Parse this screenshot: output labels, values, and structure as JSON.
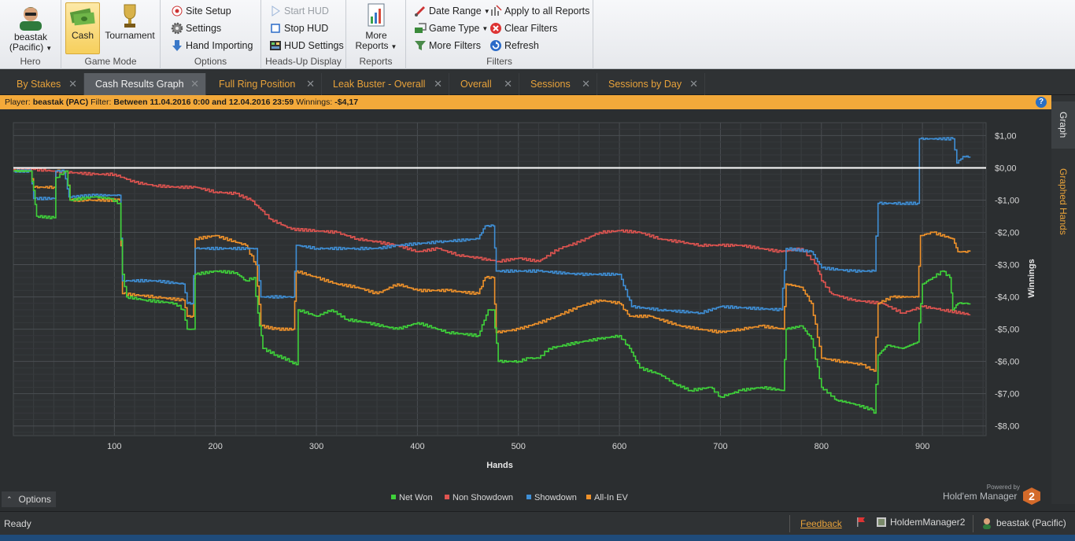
{
  "ribbon": {
    "hero": {
      "user": "beastak",
      "site": "(Pacific)",
      "label": "Hero"
    },
    "game_mode": {
      "cash": "Cash",
      "tournament": "Tournament",
      "label": "Game Mode"
    },
    "options": {
      "site_setup": "Site Setup",
      "settings": "Settings",
      "hand_importing": "Hand Importing",
      "label": "Options"
    },
    "hud": {
      "start": "Start HUD",
      "stop": "Stop HUD",
      "settings": "HUD Settings",
      "label": "Heads-Up Display"
    },
    "reports": {
      "more_line1": "More",
      "more_line2": "Reports",
      "label": "Reports"
    },
    "filters": {
      "date_range": "Date Range",
      "game_type": "Game Type",
      "more_filters": "More Filters",
      "apply_all": "Apply to all Reports",
      "clear": "Clear Filters",
      "refresh": "Refresh",
      "label": "Filters"
    }
  },
  "tabs": [
    {
      "label": "By Stakes"
    },
    {
      "label": "Cash Results Graph"
    },
    {
      "label": "Full Ring Position"
    },
    {
      "label": "Leak Buster - Overall"
    },
    {
      "label": "Overall"
    },
    {
      "label": "Sessions"
    },
    {
      "label": "Sessions by Day"
    }
  ],
  "infobar": {
    "player_label": "Player:",
    "player": "beastak (PAC)",
    "filter_label": "Filter:",
    "filter": "Between 11.04.2016 0:00 and 12.04.2016 23:59",
    "winnings_label": "Winnings:",
    "winnings": "-$4,17"
  },
  "sidetabs": {
    "graph": "Graph",
    "graphed_hands": "Graphed Hands"
  },
  "chart_data": {
    "type": "line",
    "xlabel": "Hands",
    "ylabel": "Winnings",
    "xlim": [
      0,
      963
    ],
    "ylim": [
      -8.3,
      1.4
    ],
    "x_ticks": [
      100,
      200,
      300,
      400,
      500,
      600,
      700,
      800,
      900
    ],
    "y_ticks": [
      1,
      0,
      -1,
      -2,
      -3,
      -4,
      -5,
      -6,
      -7,
      -8
    ],
    "y_tick_labels": [
      "$1,00",
      "$0,00",
      "-$1,00",
      "-$2,00",
      "-$3,00",
      "-$4,00",
      "-$5,00",
      "-$6,00",
      "-$7,00",
      "-$8,00"
    ],
    "grid": true,
    "legend": "bottom-center",
    "zero_line": true,
    "series": [
      {
        "name": "Net Won",
        "color": "#3fd23a",
        "points": [
          [
            0,
            -0.1
          ],
          [
            17,
            -0.1
          ],
          [
            20,
            -0.7
          ],
          [
            23,
            -1.5
          ],
          [
            40,
            -1.55
          ],
          [
            42,
            -0.3
          ],
          [
            52,
            -0.1
          ],
          [
            56,
            -1.0
          ],
          [
            80,
            -0.9
          ],
          [
            95,
            -0.95
          ],
          [
            105,
            -1.1
          ],
          [
            108,
            -3.3
          ],
          [
            112,
            -4.0
          ],
          [
            130,
            -4.1
          ],
          [
            160,
            -4.2
          ],
          [
            168,
            -4.4
          ],
          [
            172,
            -5.0
          ],
          [
            178,
            -5.0
          ],
          [
            180,
            -3.3
          ],
          [
            200,
            -3.2
          ],
          [
            220,
            -3.25
          ],
          [
            230,
            -3.5
          ],
          [
            238,
            -3.4
          ],
          [
            242,
            -4.5
          ],
          [
            247,
            -5.6
          ],
          [
            260,
            -5.8
          ],
          [
            275,
            -6.0
          ],
          [
            280,
            -6.1
          ],
          [
            282,
            -4.4
          ],
          [
            300,
            -4.6
          ],
          [
            315,
            -4.4
          ],
          [
            330,
            -4.7
          ],
          [
            350,
            -4.8
          ],
          [
            380,
            -5.0
          ],
          [
            400,
            -4.8
          ],
          [
            430,
            -5.1
          ],
          [
            460,
            -5.2
          ],
          [
            470,
            -4.4
          ],
          [
            475,
            -4.4
          ],
          [
            480,
            -6.0
          ],
          [
            500,
            -6.0
          ],
          [
            510,
            -5.9
          ],
          [
            520,
            -5.9
          ],
          [
            530,
            -5.6
          ],
          [
            560,
            -5.4
          ],
          [
            580,
            -5.3
          ],
          [
            600,
            -5.2
          ],
          [
            610,
            -5.6
          ],
          [
            620,
            -6.2
          ],
          [
            640,
            -6.4
          ],
          [
            655,
            -6.7
          ],
          [
            670,
            -6.9
          ],
          [
            690,
            -6.8
          ],
          [
            700,
            -7.1
          ],
          [
            720,
            -6.9
          ],
          [
            740,
            -6.8
          ],
          [
            762,
            -6.9
          ],
          [
            765,
            -5.0
          ],
          [
            780,
            -4.9
          ],
          [
            790,
            -5.3
          ],
          [
            800,
            -6.8
          ],
          [
            815,
            -7.2
          ],
          [
            830,
            -7.3
          ],
          [
            850,
            -7.5
          ],
          [
            852,
            -7.6
          ],
          [
            856,
            -5.8
          ],
          [
            865,
            -5.5
          ],
          [
            880,
            -5.6
          ],
          [
            895,
            -5.4
          ],
          [
            900,
            -3.6
          ],
          [
            910,
            -3.4
          ],
          [
            920,
            -3.2
          ],
          [
            927,
            -3.4
          ],
          [
            930,
            -4.4
          ],
          [
            935,
            -4.2
          ],
          [
            947,
            -4.2
          ]
        ]
      },
      {
        "name": "Non Showdown",
        "color": "#e05450",
        "points": [
          [
            0,
            -0.05
          ],
          [
            20,
            -0.05
          ],
          [
            40,
            -0.1
          ],
          [
            60,
            -0.15
          ],
          [
            80,
            -0.2
          ],
          [
            100,
            -0.2
          ],
          [
            120,
            -0.45
          ],
          [
            140,
            -0.55
          ],
          [
            160,
            -0.6
          ],
          [
            180,
            -0.6
          ],
          [
            200,
            -0.75
          ],
          [
            220,
            -0.8
          ],
          [
            235,
            -1.0
          ],
          [
            245,
            -1.3
          ],
          [
            255,
            -1.6
          ],
          [
            275,
            -1.9
          ],
          [
            300,
            -1.95
          ],
          [
            320,
            -2.0
          ],
          [
            340,
            -2.2
          ],
          [
            360,
            -2.3
          ],
          [
            380,
            -2.4
          ],
          [
            400,
            -2.6
          ],
          [
            420,
            -2.5
          ],
          [
            440,
            -2.7
          ],
          [
            460,
            -2.8
          ],
          [
            480,
            -2.9
          ],
          [
            500,
            -2.8
          ],
          [
            520,
            -2.9
          ],
          [
            540,
            -2.5
          ],
          [
            560,
            -2.3
          ],
          [
            580,
            -2.0
          ],
          [
            600,
            -1.95
          ],
          [
            620,
            -2.0
          ],
          [
            640,
            -2.2
          ],
          [
            660,
            -2.3
          ],
          [
            680,
            -2.4
          ],
          [
            700,
            -2.4
          ],
          [
            720,
            -2.4
          ],
          [
            740,
            -2.5
          ],
          [
            760,
            -2.6
          ],
          [
            780,
            -2.5
          ],
          [
            795,
            -3.0
          ],
          [
            800,
            -3.5
          ],
          [
            810,
            -3.9
          ],
          [
            830,
            -4.1
          ],
          [
            860,
            -4.2
          ],
          [
            880,
            -4.5
          ],
          [
            900,
            -4.3
          ],
          [
            920,
            -4.4
          ],
          [
            947,
            -4.55
          ]
        ]
      },
      {
        "name": "Showdown",
        "color": "#3f8fd6",
        "points": [
          [
            0,
            -0.1
          ],
          [
            17,
            -0.1
          ],
          [
            20,
            -0.95
          ],
          [
            40,
            -0.95
          ],
          [
            42,
            -0.1
          ],
          [
            50,
            -0.1
          ],
          [
            55,
            -0.9
          ],
          [
            80,
            -0.85
          ],
          [
            105,
            -0.85
          ],
          [
            108,
            -3.5
          ],
          [
            140,
            -3.5
          ],
          [
            168,
            -3.6
          ],
          [
            172,
            -4.2
          ],
          [
            177,
            -4.2
          ],
          [
            180,
            -2.5
          ],
          [
            240,
            -2.5
          ],
          [
            245,
            -4.0
          ],
          [
            277,
            -4.0
          ],
          [
            280,
            -2.4
          ],
          [
            300,
            -2.5
          ],
          [
            340,
            -2.5
          ],
          [
            360,
            -2.5
          ],
          [
            380,
            -2.4
          ],
          [
            420,
            -2.3
          ],
          [
            460,
            -2.2
          ],
          [
            467,
            -1.8
          ],
          [
            475,
            -1.8
          ],
          [
            478,
            -3.2
          ],
          [
            520,
            -3.2
          ],
          [
            560,
            -3.3
          ],
          [
            600,
            -3.3
          ],
          [
            612,
            -4.3
          ],
          [
            640,
            -4.4
          ],
          [
            680,
            -4.5
          ],
          [
            700,
            -4.3
          ],
          [
            760,
            -4.4
          ],
          [
            765,
            -2.5
          ],
          [
            790,
            -2.6
          ],
          [
            800,
            -3.1
          ],
          [
            830,
            -3.2
          ],
          [
            852,
            -3.2
          ],
          [
            856,
            -1.1
          ],
          [
            880,
            -1.1
          ],
          [
            895,
            -1.1
          ],
          [
            897,
            0.9
          ],
          [
            930,
            0.9
          ],
          [
            934,
            0.15
          ],
          [
            940,
            0.35
          ],
          [
            947,
            0.35
          ]
        ]
      },
      {
        "name": "All-In EV",
        "color": "#f0922a",
        "points": [
          [
            0,
            -0.1
          ],
          [
            17,
            -0.1
          ],
          [
            20,
            -0.6
          ],
          [
            40,
            -0.6
          ],
          [
            42,
            -0.1
          ],
          [
            52,
            -0.1
          ],
          [
            56,
            -1.0
          ],
          [
            80,
            -1.0
          ],
          [
            105,
            -1.0
          ],
          [
            108,
            -3.9
          ],
          [
            140,
            -4.0
          ],
          [
            168,
            -4.1
          ],
          [
            172,
            -4.6
          ],
          [
            177,
            -4.6
          ],
          [
            180,
            -2.2
          ],
          [
            200,
            -2.1
          ],
          [
            230,
            -2.4
          ],
          [
            240,
            -3.0
          ],
          [
            245,
            -4.9
          ],
          [
            260,
            -5.0
          ],
          [
            277,
            -5.0
          ],
          [
            280,
            -3.2
          ],
          [
            300,
            -3.4
          ],
          [
            320,
            -3.6
          ],
          [
            340,
            -3.7
          ],
          [
            360,
            -3.9
          ],
          [
            380,
            -3.6
          ],
          [
            400,
            -3.8
          ],
          [
            430,
            -3.8
          ],
          [
            460,
            -3.9
          ],
          [
            467,
            -3.4
          ],
          [
            475,
            -3.4
          ],
          [
            478,
            -5.1
          ],
          [
            500,
            -5.0
          ],
          [
            530,
            -4.7
          ],
          [
            560,
            -4.3
          ],
          [
            580,
            -4.1
          ],
          [
            600,
            -4.2
          ],
          [
            610,
            -4.6
          ],
          [
            630,
            -4.6
          ],
          [
            660,
            -4.9
          ],
          [
            680,
            -5.0
          ],
          [
            700,
            -5.1
          ],
          [
            720,
            -5.0
          ],
          [
            740,
            -4.9
          ],
          [
            762,
            -5.0
          ],
          [
            765,
            -3.6
          ],
          [
            780,
            -3.7
          ],
          [
            790,
            -4.2
          ],
          [
            800,
            -5.9
          ],
          [
            820,
            -6.0
          ],
          [
            840,
            -6.1
          ],
          [
            852,
            -6.3
          ],
          [
            856,
            -4.2
          ],
          [
            870,
            -4.0
          ],
          [
            895,
            -4.0
          ],
          [
            898,
            -2.1
          ],
          [
            910,
            -2.0
          ],
          [
            930,
            -2.2
          ],
          [
            935,
            -2.6
          ],
          [
            947,
            -2.6
          ]
        ]
      }
    ]
  },
  "options_label": "Options",
  "powered": {
    "small": "Powered by",
    "brand": "Hold'em Manager",
    "logo": "2"
  },
  "status": {
    "ready": "Ready",
    "feedback": "Feedback",
    "app": "HoldemManager2",
    "user": "beastak (Pacific)"
  }
}
